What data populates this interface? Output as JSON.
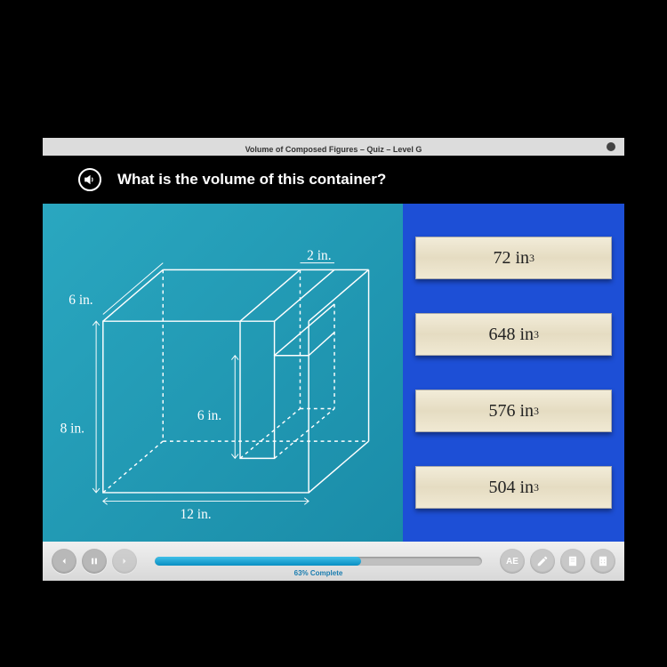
{
  "header": {
    "title": "Volume of Composed Figures – Quiz – Level G"
  },
  "question": {
    "text": "What is the volume of this container?"
  },
  "figure": {
    "dims": {
      "depth_top": "6 in.",
      "notch_width": "2 in.",
      "height_left": "8 in.",
      "notch_height": "6 in.",
      "width_bottom": "12 in."
    }
  },
  "answers": [
    {
      "value": "72 in",
      "exp": "3"
    },
    {
      "value": "648 in",
      "exp": "3"
    },
    {
      "value": "576 in",
      "exp": "3"
    },
    {
      "value": "504 in",
      "exp": "3"
    }
  ],
  "progress": {
    "percent": 63,
    "label": "63% Complete"
  },
  "chart_data": {
    "type": "table",
    "title": "Composed rectangular prism with notch",
    "outer_prism": {
      "length_in": 12,
      "width_in": 6,
      "height_in": 8
    },
    "notch_prism": {
      "length_in": 2,
      "width_in": 6,
      "height_in": 6
    },
    "answer_choices_in3": [
      72,
      648,
      576,
      504
    ]
  }
}
